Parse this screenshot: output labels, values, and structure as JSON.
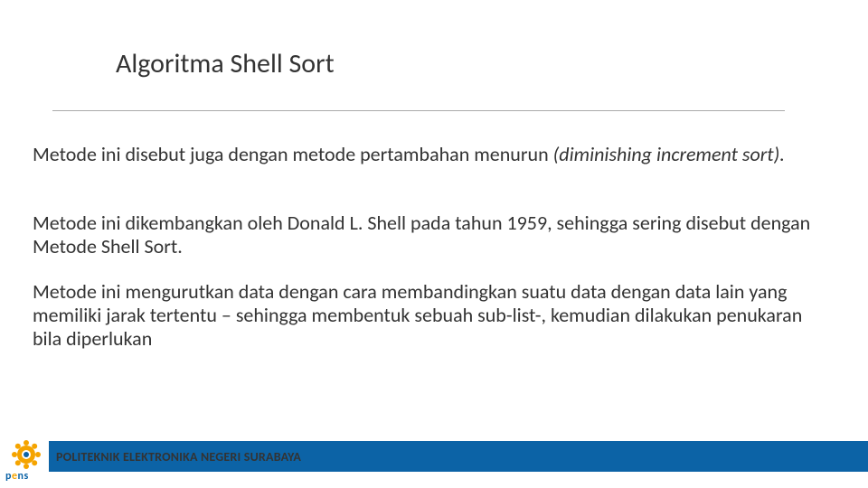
{
  "title": "Algoritma Shell Sort",
  "paragraphs": {
    "p1_plain": "Metode ini disebut juga dengan metode pertambahan menurun ",
    "p1_italic": "(diminishing increment sort).",
    "p2": "Metode ini dikembangkan oleh Donald L. Shell pada tahun 1959, sehingga sering disebut dengan Metode Shell Sort.",
    "p3": "Metode ini mengurutkan data dengan cara membandingkan suatu data dengan data lain yang memiliki jarak tertentu – sehingga membentuk sebuah sub-list-, kemudian dilakukan penukaran bila diperlukan"
  },
  "footer": "POLITEKNIK ELEKTRONIKA NEGERI SURABAYA",
  "logo": {
    "text_p": "p",
    "text_e": "e",
    "text_n": "n",
    "text_s": "s"
  },
  "colors": {
    "accent": "#0c63a6",
    "gear": "#f5a400"
  }
}
